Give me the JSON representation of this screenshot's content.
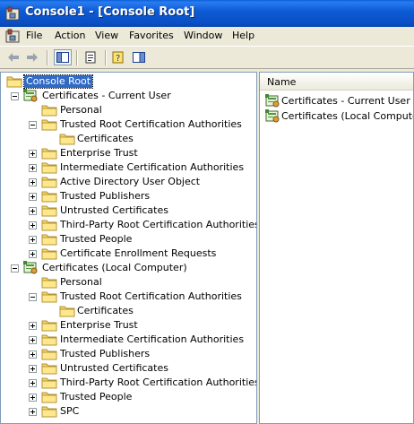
{
  "window": {
    "title": "Console1 - [Console Root]",
    "title_bar_color": "#0a4fc4"
  },
  "menu": {
    "items": [
      "File",
      "Action",
      "View",
      "Favorites",
      "Window",
      "Help"
    ]
  },
  "toolbar": {
    "buttons": [
      "back-icon",
      "forward-icon",
      "show-hide-tree-icon",
      "export-list-icon",
      "help-icon",
      "action-pane-icon"
    ]
  },
  "tree": {
    "root": "Console Root",
    "current_user": {
      "label": "Certificates - Current User",
      "children": [
        "Personal",
        "Trusted Root Certification Authorities",
        "Certificates",
        "Enterprise Trust",
        "Intermediate Certification Authorities",
        "Active Directory User Object",
        "Trusted Publishers",
        "Untrusted Certificates",
        "Third-Party Root Certification Authorities",
        "Trusted People",
        "Certificate Enrollment Requests"
      ]
    },
    "local_computer": {
      "label": "Certificates (Local Computer)",
      "children": [
        "Personal",
        "Trusted Root Certification Authorities",
        "Certificates",
        "Enterprise Trust",
        "Intermediate Certification Authorities",
        "Trusted Publishers",
        "Untrusted Certificates",
        "Third-Party Root Certification Authorities",
        "Trusted People",
        "SPC"
      ]
    }
  },
  "list": {
    "column_header": "Name",
    "items": [
      "Certificates - Current User",
      "Certificates (Local Computer)"
    ]
  }
}
